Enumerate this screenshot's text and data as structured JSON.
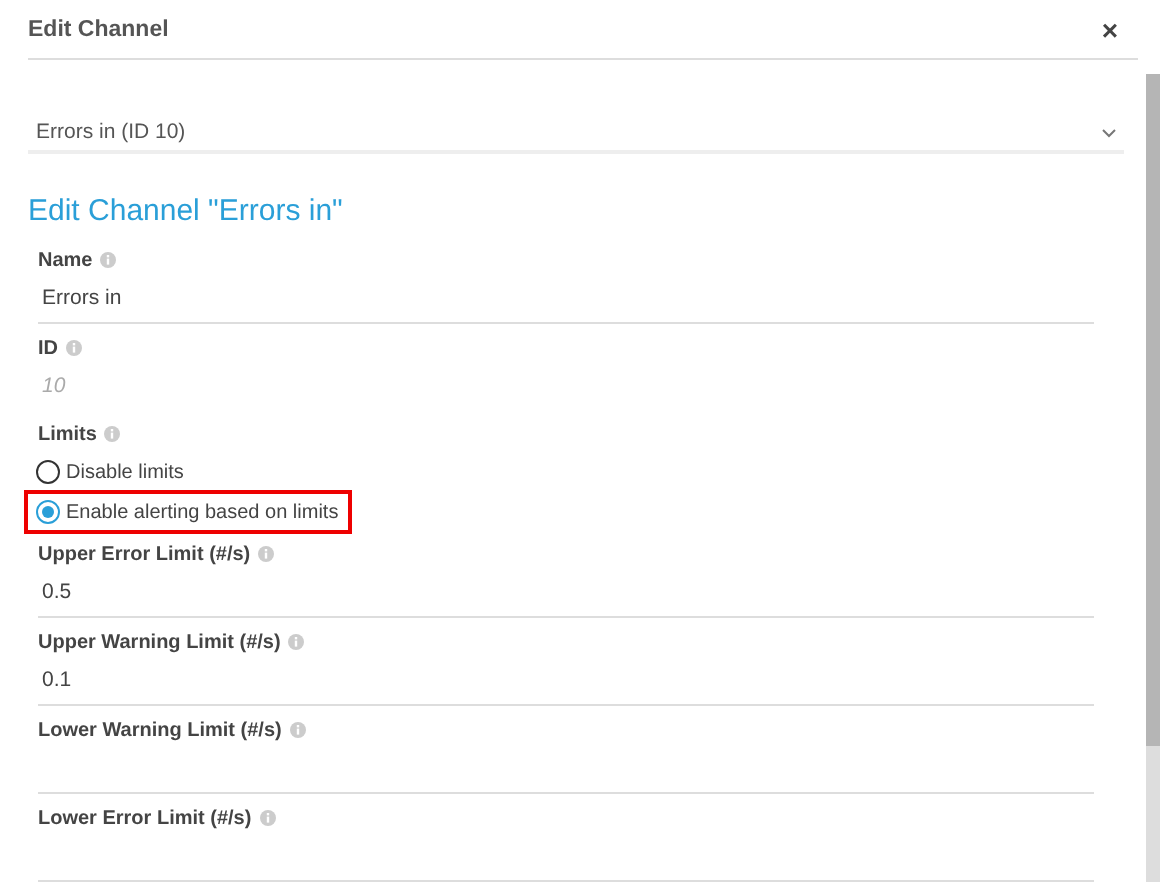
{
  "dialog": {
    "title": "Edit Channel",
    "close": "×"
  },
  "channel_select": {
    "value": "Errors in (ID 10)"
  },
  "heading": "Edit Channel \"Errors in\"",
  "fields": [
    {
      "kind": "text",
      "label": "Name",
      "value": "Errors in"
    },
    {
      "kind": "readonly",
      "label": "ID",
      "value": "10"
    },
    {
      "kind": "radio",
      "label": "Limits",
      "options": [
        {
          "label": "Disable limits",
          "selected": false,
          "highlighted": false
        },
        {
          "label": "Enable alerting based on limits",
          "selected": true,
          "highlighted": true
        }
      ]
    },
    {
      "kind": "text",
      "label": "Upper Error Limit (#/s)",
      "value": "0.5"
    },
    {
      "kind": "text",
      "label": "Upper Warning Limit (#/s)",
      "value": "0.1"
    },
    {
      "kind": "text",
      "label": "Lower Warning Limit (#/s)"
    },
    {
      "kind": "text",
      "label": "Lower Error Limit (#/s)"
    }
  ]
}
